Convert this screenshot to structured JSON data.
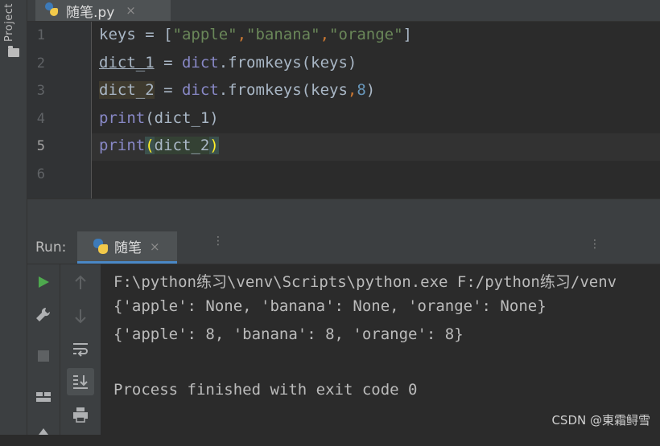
{
  "sidebar": {
    "project_label": "Project"
  },
  "editor_tab": {
    "title": "随笔.py",
    "close": "×"
  },
  "editor": {
    "line_numbers": [
      "1",
      "2",
      "3",
      "4",
      "5",
      "6"
    ],
    "lines": {
      "l1_a": "keys = [",
      "l1_s1": "\"apple\"",
      "l1_c1": ",",
      "l1_s2": "\"banana\"",
      "l1_c2": ",",
      "l1_s3": "\"orange\"",
      "l1_b": "]",
      "l2_var": "dict_1",
      "l2_eq": " = ",
      "l2_fn": "dict",
      "l2_rest": ".fromkeys(keys)",
      "l3_var": "dict_2",
      "l3_eq": " = ",
      "l3_fn": "dict",
      "l3_rest": ".fromkeys(keys",
      "l3_comma": ",",
      "l3_num": "8",
      "l3_end": ")",
      "l4_fn": "print",
      "l4_rest": "(dict_1)",
      "l5_fn": "print",
      "l5_open": "(",
      "l5_arg": "dict_2",
      "l5_close": ")"
    }
  },
  "run_panel": {
    "label": "Run:",
    "tab_title": "随笔",
    "tab_close": "×",
    "output": [
      "F:\\python练习\\venv\\Scripts\\python.exe F:/python练习/venv",
      "{'apple': None, 'banana': None, 'orange': None}",
      "{'apple': 8, 'banana': 8, 'orange': 8}",
      "",
      "Process finished with exit code 0"
    ]
  },
  "icons": [
    "folder-icon",
    "python-file-icon",
    "run-icon",
    "wrench-icon",
    "stop-icon",
    "layout-icon",
    "pin-icon",
    "up-arrow-icon",
    "down-arrow-icon",
    "soft-wrap-icon",
    "scroll-to-end-icon",
    "print-icon"
  ],
  "colors": {
    "run_green": "#4ea94e",
    "accent_blue": "#4a88c7"
  },
  "watermark": "CSDN @東霜鲟雪"
}
